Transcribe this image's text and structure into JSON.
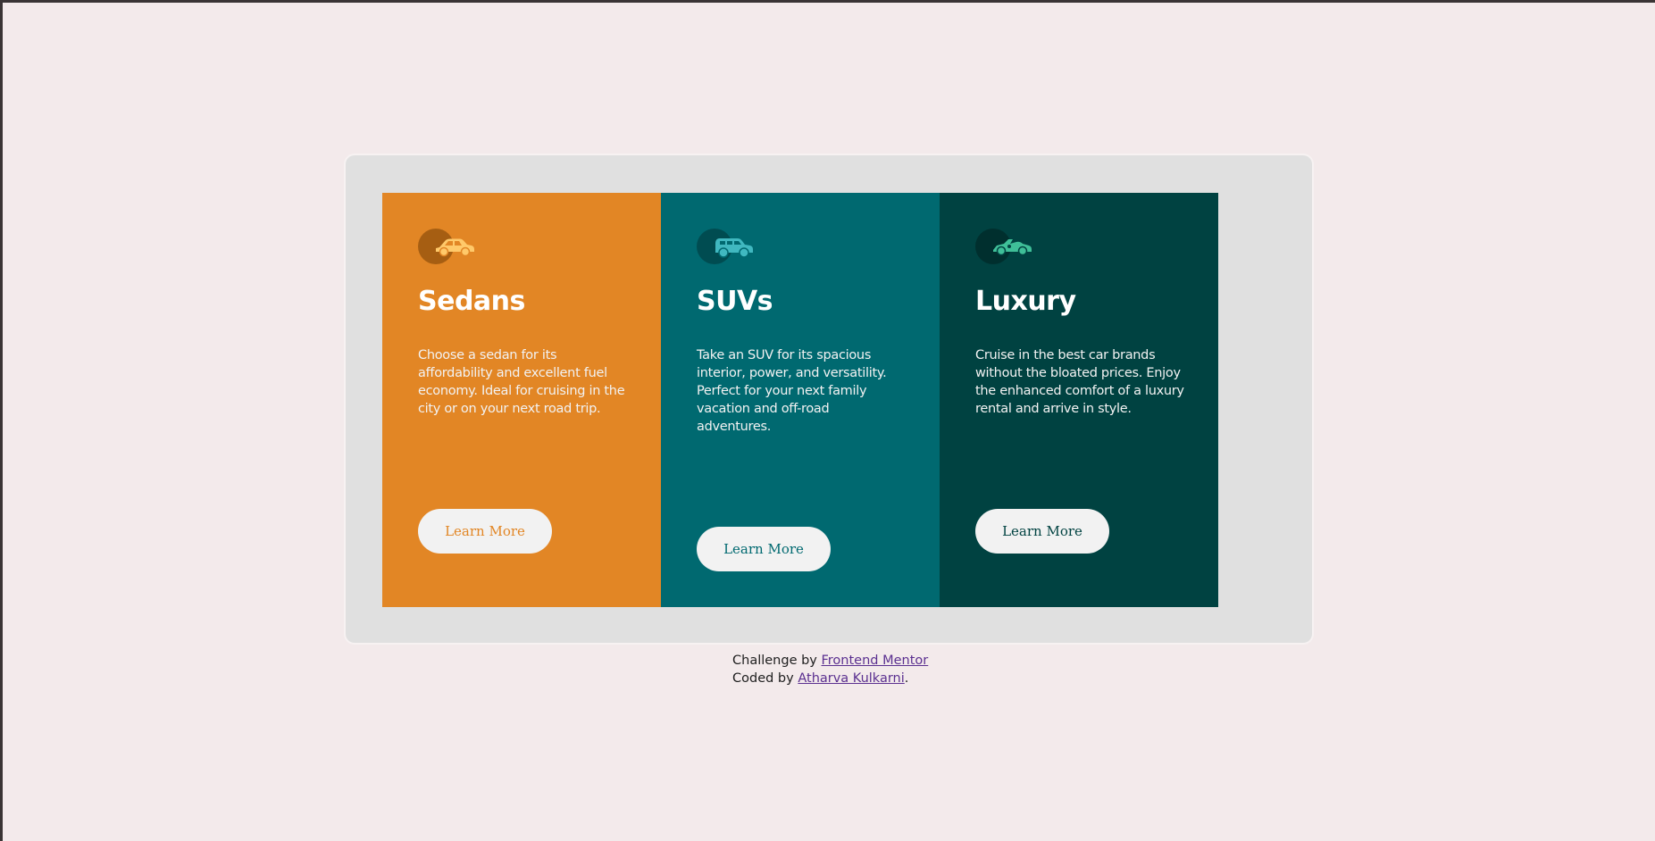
{
  "colors": {
    "page_bg": "#f3eaeb",
    "container_bg": "#e0e0e0",
    "sedans": "#e28625",
    "suvs": "#006970",
    "luxury": "#004241",
    "button_bg": "#f2f2f2",
    "link": "#5b3090"
  },
  "cards": [
    {
      "icon": "sedan-car-icon",
      "title": "Sedans",
      "description": "Choose a sedan for its affordability and excellent fuel economy. Ideal for cruising in the city or on your next road trip.",
      "button_label": "Learn More"
    },
    {
      "icon": "suv-car-icon",
      "title": "SUVs",
      "description": "Take an SUV for its spacious interior, power, and versatility. Perfect for your next family vacation and off-road adventures.",
      "button_label": "Learn More"
    },
    {
      "icon": "luxury-car-icon",
      "title": "Luxury",
      "description": "Cruise in the best car brands without the bloated prices. Enjoy the enhanced comfort of a luxury rental and arrive in style.",
      "button_label": "Learn More"
    }
  ],
  "attribution": {
    "challenge_prefix": "Challenge by ",
    "challenge_link": "Frontend Mentor",
    "coded_prefix": "Coded by ",
    "coded_link": "Atharva Kulkarni",
    "coded_suffix": "."
  }
}
